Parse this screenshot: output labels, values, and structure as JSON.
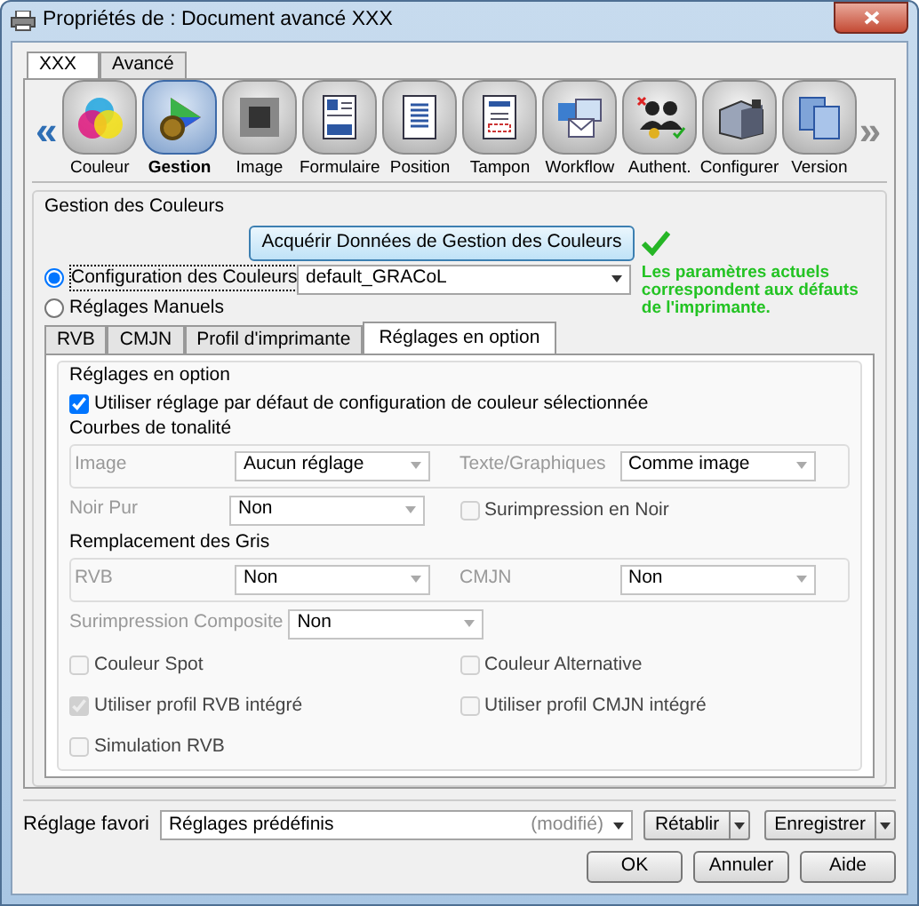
{
  "window": {
    "title": "Propriétés de : Document avancé XXX"
  },
  "top_tabs": [
    {
      "label": "XXX",
      "selected": true
    },
    {
      "label": "Avancé",
      "selected": false
    }
  ],
  "toolbar": {
    "prev": "«",
    "next": "»",
    "next_disabled": true,
    "items": [
      {
        "label": "Couleur",
        "selected": false
      },
      {
        "label": "Gestion",
        "selected": true
      },
      {
        "label": "Image",
        "selected": false
      },
      {
        "label": "Formulaire",
        "selected": false
      },
      {
        "label": "Position",
        "selected": false
      },
      {
        "label": "Tampon",
        "selected": false
      },
      {
        "label": "Workflow",
        "selected": false
      },
      {
        "label": "Authent.",
        "selected": false
      },
      {
        "label": "Configurer",
        "selected": false
      },
      {
        "label": "Version",
        "selected": false
      }
    ]
  },
  "color_management": {
    "title": "Gestion des Couleurs",
    "acquire_button": "Acquérir Données de Gestion des Couleurs",
    "modes": [
      {
        "label": "Configuration des Couleurs",
        "selected": true
      },
      {
        "label": "Réglages Manuels",
        "selected": false
      }
    ],
    "configuration": "default_GRACoL",
    "status": "Les paramètres actuels correspondent aux défauts de l'imprimante.",
    "sub_tabs": [
      {
        "label": "RVB",
        "selected": false
      },
      {
        "label": "CMJN",
        "selected": false
      },
      {
        "label": "Profil d'imprimante",
        "selected": false
      },
      {
        "label": "Réglages en option",
        "selected": true
      }
    ],
    "options": {
      "title": "Réglages en option",
      "use_default": {
        "label": "Utiliser réglage par défaut de configuration de couleur sélectionnée",
        "checked": true
      },
      "blocks": [
        {
          "kind": "group",
          "title": "Courbes de tonalité",
          "items": [
            {
              "kind": "select",
              "label": "Image",
              "value": "Aucun réglage",
              "disabled": true
            },
            {
              "kind": "select",
              "label": "Texte/Graphiques",
              "value": "Comme image",
              "disabled": true
            }
          ]
        },
        {
          "kind": "row",
          "items": [
            {
              "kind": "select",
              "label": "Noir Pur",
              "value": "Non",
              "disabled": true
            },
            {
              "kind": "checkbox",
              "label": "Surimpression en Noir",
              "checked": false,
              "disabled": true
            }
          ]
        },
        {
          "kind": "group",
          "title": "Remplacement des Gris",
          "items": [
            {
              "kind": "select",
              "label": "RVB",
              "value": "Non",
              "disabled": true
            },
            {
              "kind": "select",
              "label": "CMJN",
              "value": "Non",
              "disabled": true
            }
          ]
        },
        {
          "kind": "row",
          "items": [
            {
              "kind": "inline_select",
              "label": "Surimpression Composite",
              "value": "Non",
              "disabled": true
            }
          ]
        },
        {
          "kind": "row",
          "items": [
            {
              "kind": "checkbox",
              "label": "Couleur Spot",
              "checked": false,
              "disabled": true
            },
            {
              "kind": "checkbox",
              "label": "Couleur Alternative",
              "checked": false,
              "disabled": true
            }
          ]
        },
        {
          "kind": "row",
          "items": [
            {
              "kind": "checkbox",
              "label": "Utiliser profil RVB intégré",
              "checked": true,
              "disabled": true
            },
            {
              "kind": "checkbox",
              "label": "Utiliser profil CMJN intégré",
              "checked": false,
              "disabled": true
            }
          ]
        },
        {
          "kind": "row",
          "items": [
            {
              "kind": "checkbox",
              "label": "Simulation RVB",
              "checked": false,
              "disabled": true
            }
          ]
        }
      ]
    }
  },
  "favorite": {
    "label": "Réglage favori",
    "value": "Réglages prédéfinis",
    "note": "(modifié)",
    "buttons": [
      "Rétablir",
      "Enregistrer"
    ]
  },
  "buttons": [
    "OK",
    "Annuler",
    "Aide"
  ]
}
